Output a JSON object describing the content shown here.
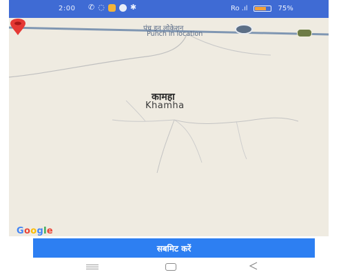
{
  "status_bar": {
    "time": "2:00",
    "signal_text": "Ro .ıl ",
    "battery_percent": "75%",
    "battery_level": 0.75,
    "icons": [
      "call-icon",
      "whatsapp-icon",
      "app-icon",
      "app-icon",
      "settings-icon"
    ]
  },
  "map": {
    "current_location_label_hi": "पंच इन लोकेशन",
    "current_location_label_en": "Punch in location",
    "place_name_hi": "कामहा",
    "place_name_en": "Khamha",
    "google_logo": "Google",
    "marker_color": "#e53935",
    "land_color": "#efebe1",
    "road_color": "#7f96b2"
  },
  "actions": {
    "submit_label": "सबमिट करें",
    "submit_color": "#2d7ff2"
  },
  "nav_bar": {
    "icons": [
      "recent-apps-icon",
      "home-icon",
      "back-icon"
    ]
  }
}
